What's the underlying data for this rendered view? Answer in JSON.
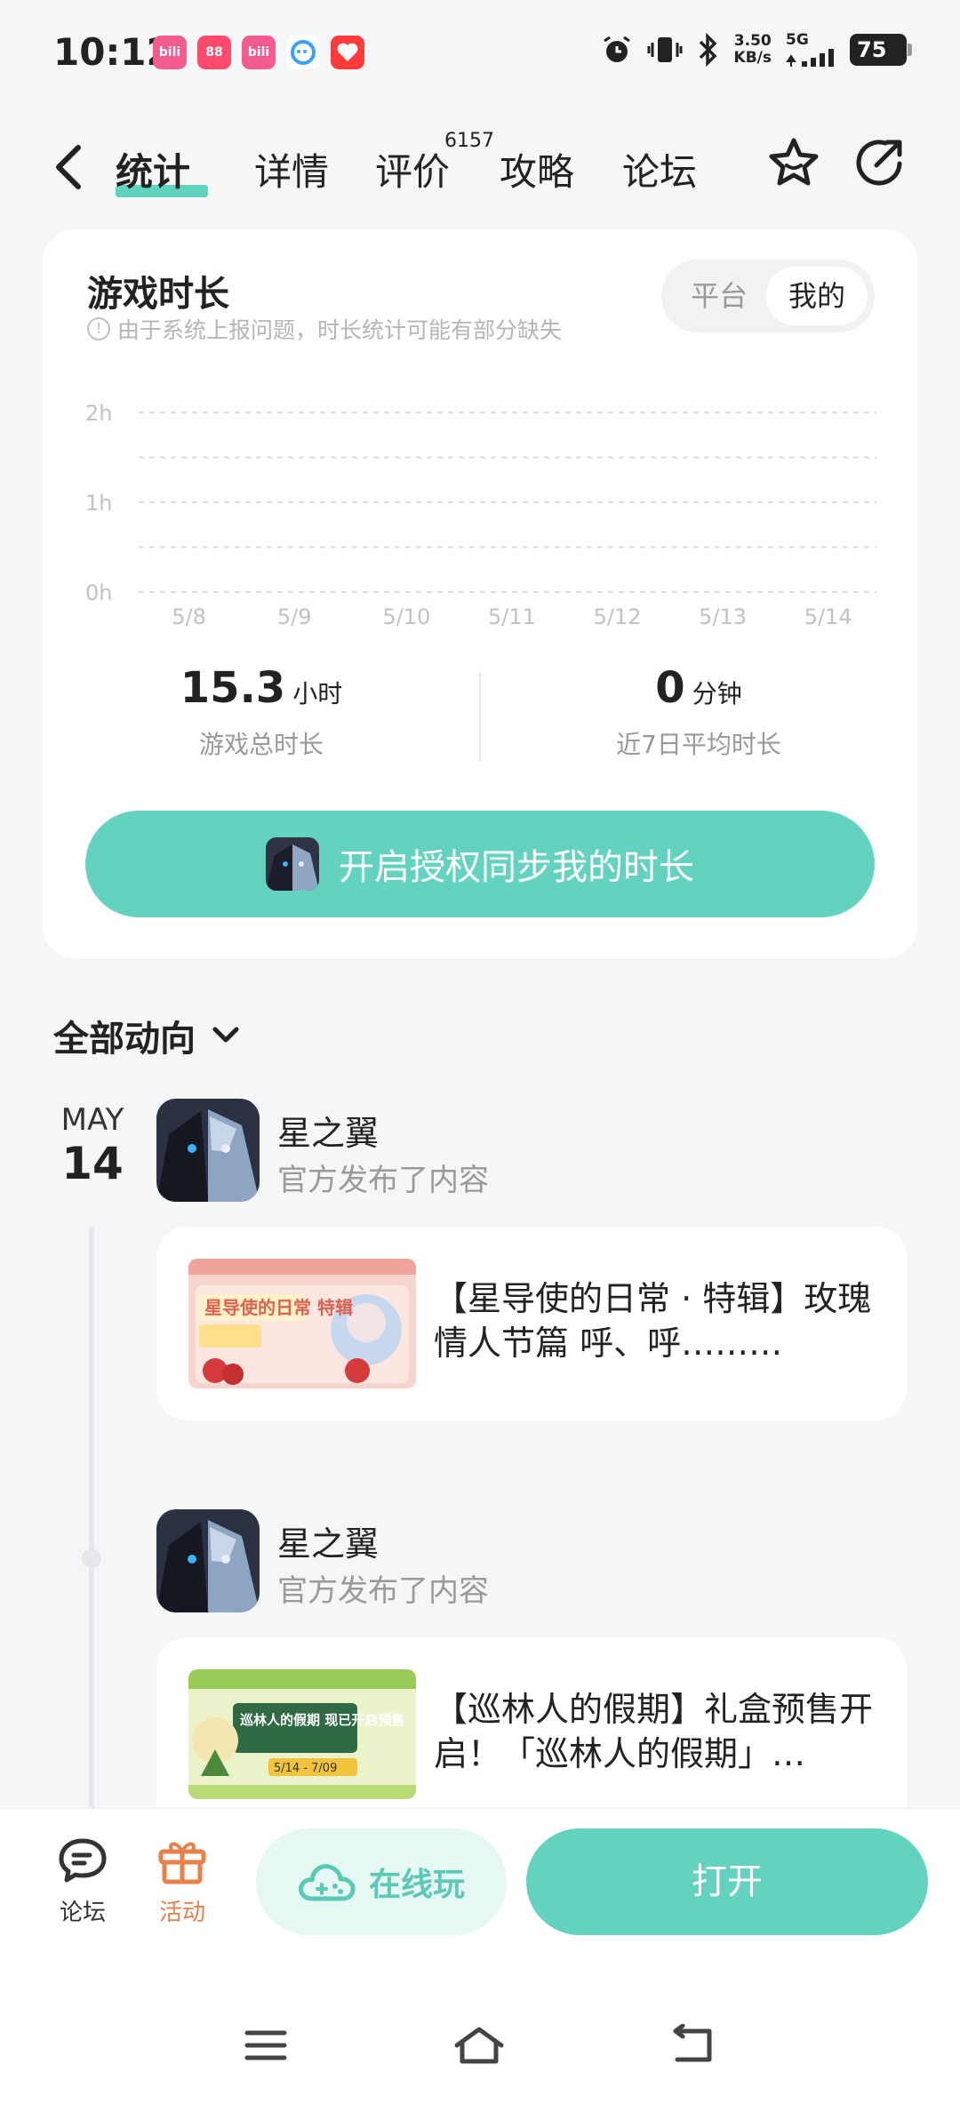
{
  "status": {
    "time": "10:12",
    "net_speed_top": "3.50",
    "net_speed_bottom": "KB/s",
    "net_type": "5G",
    "battery": "75",
    "apps": [
      {
        "name": "bilibili-icon",
        "color": "#f25d8e",
        "label": "bili"
      },
      {
        "name": "photo-app-icon",
        "color": "#ff4a6b",
        "label": "88"
      },
      {
        "name": "bilibili-icon",
        "color": "#f25d8e",
        "label": "bili"
      },
      {
        "name": "chat-app-icon",
        "color": "#ffffff",
        "label": ""
      },
      {
        "name": "heart-app-icon",
        "color": "#ff3b3b",
        "label": ""
      }
    ]
  },
  "header": {
    "tabs": [
      {
        "label": "统计",
        "active": true
      },
      {
        "label": "详情",
        "active": false
      },
      {
        "label": "评价",
        "active": false
      },
      {
        "label": "攻略",
        "active": false
      },
      {
        "label": "论坛",
        "active": false
      }
    ],
    "review_count": "6157"
  },
  "stats_card": {
    "title": "游戏时长",
    "note": "由于系统上报问题，时长统计可能有部分缺失",
    "segments": [
      "平台",
      "我的"
    ],
    "active_segment": "我的",
    "total_value": "15.3",
    "total_unit": "小时",
    "total_label": "游戏总时长",
    "avg_value": "0",
    "avg_unit": "分钟",
    "avg_label": "近7日平均时长",
    "auth_button": "开启授权同步我的时长"
  },
  "chart_data": {
    "type": "bar",
    "categories": [
      "5/8",
      "5/9",
      "5/10",
      "5/11",
      "5/12",
      "5/13",
      "5/14"
    ],
    "values": [
      0,
      0,
      0,
      0,
      0,
      0,
      0
    ],
    "ylabels": [
      "2h",
      "1h",
      "0h"
    ],
    "ylim": [
      0,
      2
    ],
    "grid": true,
    "gridline_color": "#dcdcdc"
  },
  "feed": {
    "filter_label": "全部动向",
    "date_month": "MAY",
    "date_day": "14",
    "posts": [
      {
        "author": "星之翼",
        "action": "官方发布了内容",
        "text": "【星导使的日常 · 特辑】玫瑰情人节篇 呼、呼………",
        "thumb_title": "星导使的日常 特辑"
      },
      {
        "author": "星之翼",
        "action": "官方发布了内容",
        "text": "【巡林人的假期】礼盒预售开启！「巡林人的假期」…",
        "thumb_title": "巡林人的假期 现已开启预售",
        "thumb_date": "5/14 - 7/09"
      }
    ]
  },
  "bottom": {
    "forum_label": "论坛",
    "activity_label": "活动",
    "online_label": "在线玩",
    "open_label": "打开",
    "accent": "#63d3c0",
    "activity_color": "#e8804a"
  }
}
